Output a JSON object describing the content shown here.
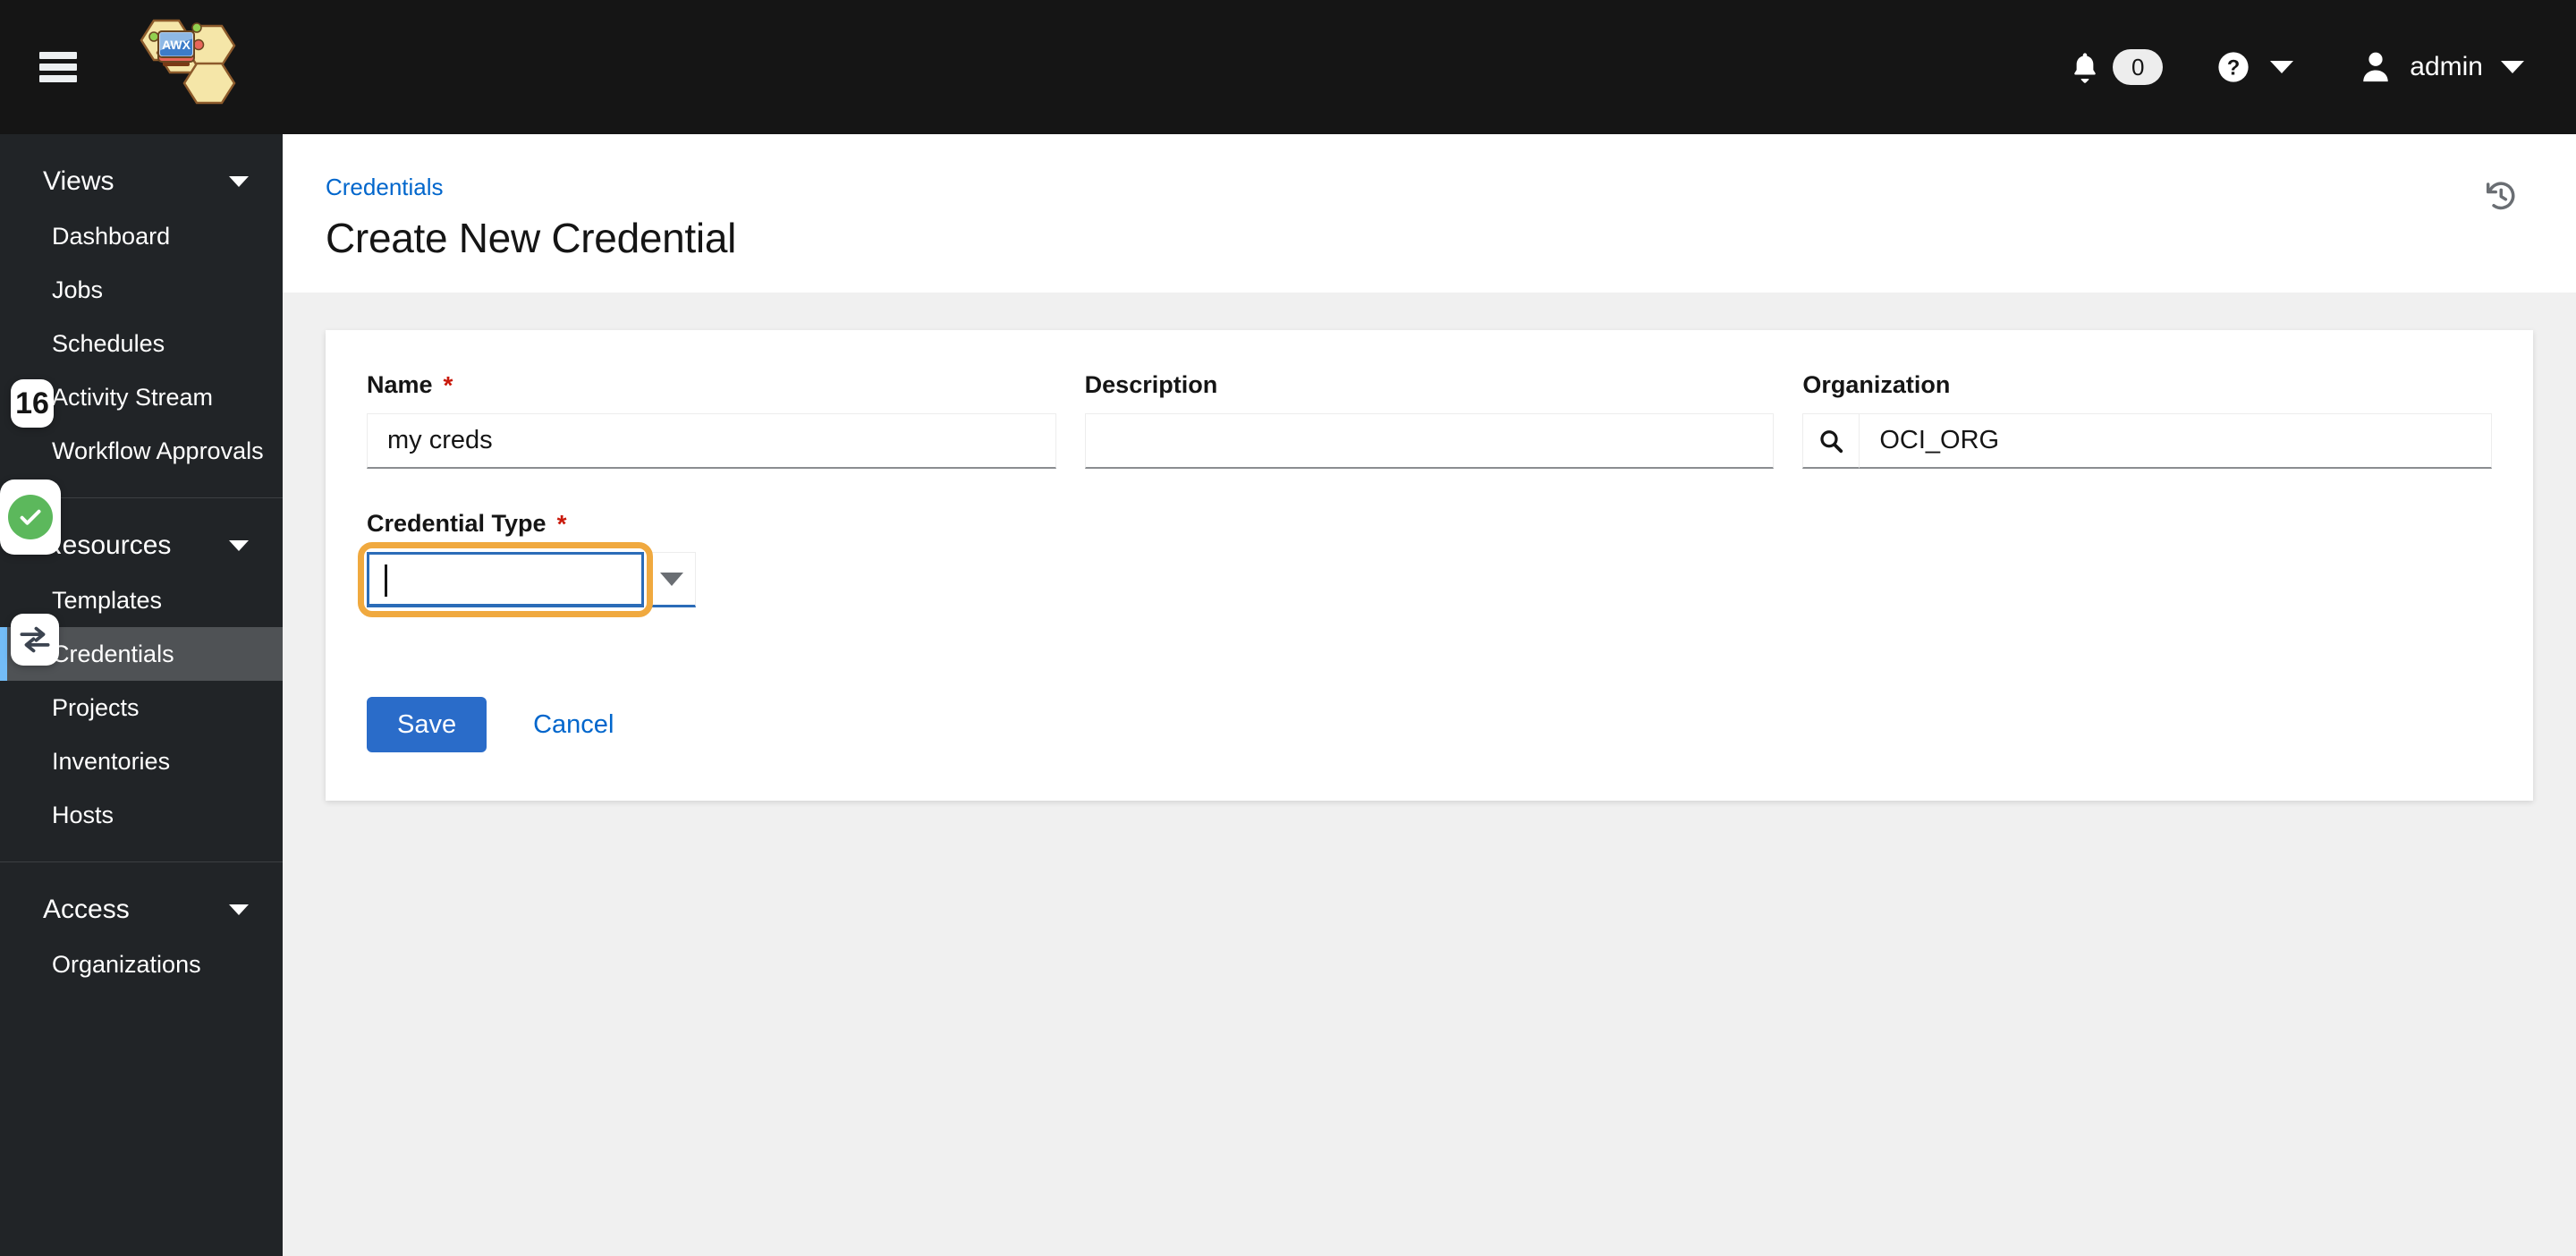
{
  "masthead": {
    "hamburger_label": "Toggle navigation",
    "brand": "AWX",
    "notifications": {
      "icon": "bell-icon",
      "count": "0"
    },
    "help": {
      "icon": "help-circle-icon",
      "caret": "chevron-down-icon"
    },
    "user": {
      "icon": "user-icon",
      "name": "admin",
      "caret": "chevron-down-icon"
    }
  },
  "sidebar": {
    "groups": [
      {
        "label": "Views",
        "caret": "chevron-down-icon",
        "items": [
          {
            "label": "Dashboard",
            "active": false
          },
          {
            "label": "Jobs",
            "active": false
          },
          {
            "label": "Schedules",
            "active": false
          },
          {
            "label": "Activity Stream",
            "active": false
          },
          {
            "label": "Workflow Approvals",
            "active": false
          }
        ]
      },
      {
        "label": "Resources",
        "caret": "chevron-down-icon",
        "items": [
          {
            "label": "Templates",
            "active": false
          },
          {
            "label": "Credentials",
            "active": true
          },
          {
            "label": "Projects",
            "active": false
          },
          {
            "label": "Inventories",
            "active": false
          },
          {
            "label": "Hosts",
            "active": false
          }
        ]
      },
      {
        "label": "Access",
        "caret": "chevron-down-icon",
        "items": [
          {
            "label": "Organizations",
            "active": false
          }
        ]
      }
    ]
  },
  "overlays": [
    {
      "name": "step-badge-16",
      "text": "16",
      "icon": null
    },
    {
      "name": "status-success-badge",
      "text": "",
      "icon": "check-circle-icon"
    },
    {
      "name": "swap-badge",
      "text": "",
      "icon": "exchange-arrows-icon"
    }
  ],
  "content": {
    "breadcrumb": "Credentials",
    "title": "Create New Credential",
    "history_icon": "history-icon"
  },
  "form": {
    "name": {
      "label": "Name",
      "required": "*",
      "value": "my creds",
      "placeholder": ""
    },
    "description": {
      "label": "Description",
      "required": "",
      "value": "",
      "placeholder": ""
    },
    "organization": {
      "label": "Organization",
      "required": "",
      "value": "OCI_ORG",
      "placeholder": "",
      "search_icon": "search-icon"
    },
    "credential_type": {
      "label": "Credential Type",
      "required": "*",
      "value": "",
      "placeholder": "",
      "toggle_icon": "caret-down-icon"
    },
    "actions": {
      "save_label": "Save",
      "cancel_label": "Cancel"
    }
  },
  "colors": {
    "masthead_bg": "#151515",
    "sidebar_bg": "#212427",
    "sidebar_active_bg": "#4f5255",
    "sidebar_active_accent": "#73bcf7",
    "link_blue": "#0066cc",
    "primary_button": "#2a6cc9",
    "required_red": "#c9190b",
    "focus_ring_orange": "#f0a93f",
    "input_focus_blue": "#2b6cb8",
    "success_green": "#5cb85c",
    "page_bg": "#f0f0f0"
  }
}
